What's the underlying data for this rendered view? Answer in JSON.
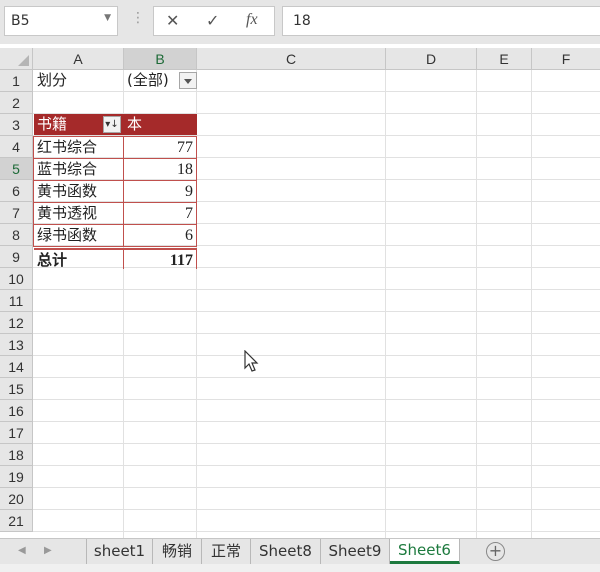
{
  "formula_bar": {
    "name_box": "B5",
    "cancel_icon": "✕",
    "enter_icon": "✓",
    "fx_label": "fx",
    "formula_value": "18"
  },
  "columns": [
    "A",
    "B",
    "C",
    "D",
    "E",
    "F"
  ],
  "rows": [
    "1",
    "2",
    "3",
    "4",
    "5",
    "6",
    "7",
    "8",
    "9",
    "10",
    "11",
    "12",
    "13",
    "14",
    "15",
    "16",
    "17",
    "18",
    "19",
    "20",
    "21"
  ],
  "cells": {
    "a1": "划分",
    "b1": "(全部)",
    "a3": "书籍",
    "b3": "本",
    "a9": "总计",
    "b9": "117"
  },
  "pivot_rows": [
    {
      "name": "红书综合",
      "count": "77"
    },
    {
      "name": "蓝书综合",
      "count": "18"
    },
    {
      "name": "黄书函数",
      "count": "9"
    },
    {
      "name": "黄书透视",
      "count": "7"
    },
    {
      "name": "绿书函数",
      "count": "6"
    }
  ],
  "sheet_tabs": [
    "sheet1",
    "畅销",
    "正常",
    "Sheet8",
    "Sheet9",
    "Sheet6"
  ],
  "active_tab": "Sheet6",
  "colors": {
    "pivot_header": "#a52a2a",
    "active_tab": "#1d7a3e"
  }
}
